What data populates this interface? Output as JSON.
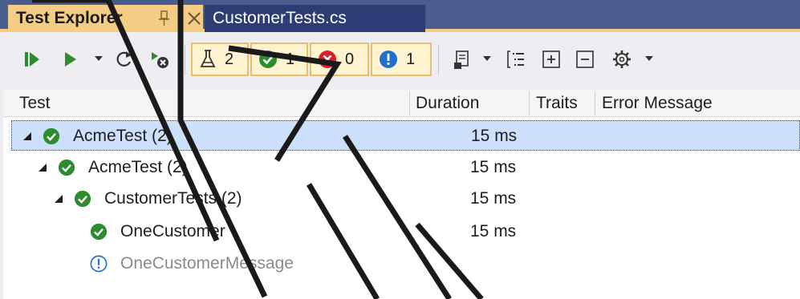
{
  "tabs": {
    "active_title": "Test Explorer",
    "doc_title": "CustomerTests.cs"
  },
  "toolbar": {
    "counters": [
      {
        "icon": "flask-icon",
        "value": "2"
      },
      {
        "icon": "passed-icon",
        "value": "1"
      },
      {
        "icon": "failed-icon",
        "value": "0"
      },
      {
        "icon": "not-run-icon",
        "value": "1"
      }
    ]
  },
  "columns": {
    "test": "Test",
    "duration": "Duration",
    "traits": "Traits",
    "error_message": "Error Message"
  },
  "rows": [
    {
      "name": "AcmeTest (2)",
      "duration": "15 ms",
      "status": "passed",
      "selected": true
    },
    {
      "name": "AcmeTest (2)",
      "duration": "15 ms",
      "status": "passed",
      "selected": false
    },
    {
      "name": "CustomerTests (2)",
      "duration": "15 ms",
      "status": "passed",
      "selected": false
    },
    {
      "name": "OneCustomer",
      "duration": "15 ms",
      "status": "passed",
      "selected": false
    },
    {
      "name": "OneCustomerMessage",
      "duration": "",
      "status": "not-run",
      "selected": false
    }
  ],
  "colors": {
    "accent_tab": "#f5cc84",
    "passed": "#2e8b2e",
    "failed": "#d81e2c",
    "not_run": "#1f6fd1",
    "selection": "#cce0fb"
  }
}
